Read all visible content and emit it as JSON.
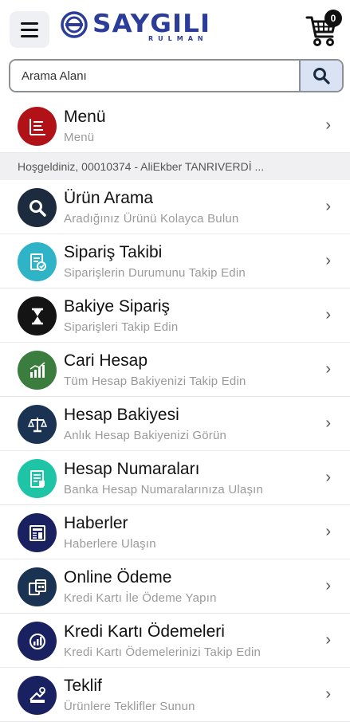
{
  "brand": {
    "name": "SAYGILI",
    "sub": "RULMAN"
  },
  "cart": {
    "count": "0"
  },
  "search": {
    "placeholder": "Arama Alanı"
  },
  "welcome": "Hoşgeldiniz, 00010374 - AliEkber TANRIVERDİ ...",
  "chevron": "›",
  "menu_top": {
    "title": "Menü",
    "subtitle": "Menü",
    "icon": "menu-list-icon",
    "color": "#b01218"
  },
  "items": [
    {
      "title": "Ürün Arama",
      "subtitle": "Aradığınız Ürünü Kolayca Bulun",
      "icon": "search-icon",
      "color": "#1c2b3d"
    },
    {
      "title": "Sipariş Takibi",
      "subtitle": "Siparişlerin Durumunu Takip Edin",
      "icon": "order-tracking-icon",
      "color": "#2fb3c6"
    },
    {
      "title": "Bakiye Sipariş",
      "subtitle": "Siparişleri Takip Edin",
      "icon": "hourglass-icon",
      "color": "#141414"
    },
    {
      "title": "Cari Hesap",
      "subtitle": "Tüm Hesap Bakiyenizi Takip Edin",
      "icon": "bar-chart-icon",
      "color": "#3b7d3f"
    },
    {
      "title": "Hesap Bakiyesi",
      "subtitle": "Anlık Hesap Bakiyenizi Görün",
      "icon": "scale-icon",
      "color": "#1b3352"
    },
    {
      "title": "Hesap Numaraları",
      "subtitle": "Banka Hesap Numaralarınıza Ulaşın",
      "icon": "bank-document-icon",
      "color": "#1ec4a6"
    },
    {
      "title": "Haberler",
      "subtitle": "Haberlere Ulaşın",
      "icon": "newspaper-icon",
      "color": "#1a2160"
    },
    {
      "title": "Online Ödeme",
      "subtitle": "Kredi Kartı İle Ödeme Yapın",
      "icon": "payment-icon",
      "color": "#1b3352"
    },
    {
      "title": "Kredi Kartı Ödemeleri",
      "subtitle": "Kredi Kartı Ödemelerinizi Takip Edin",
      "icon": "card-report-icon",
      "color": "#1a2160"
    },
    {
      "title": "Teklif",
      "subtitle": "Ürünlere Teklifler Sunun",
      "icon": "offer-icon",
      "color": "#1a2160"
    }
  ]
}
